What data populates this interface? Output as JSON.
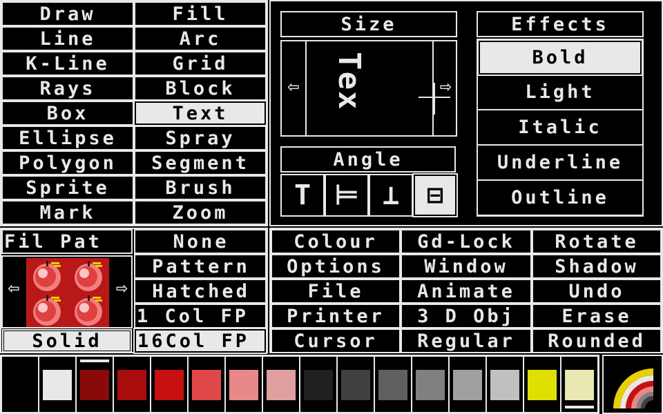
{
  "tools": {
    "left": [
      "Draw",
      "Line",
      "K-Line",
      "Rays",
      "Box",
      "Ellipse",
      "Polygon",
      "Sprite",
      "Mark"
    ],
    "right": [
      "Fill",
      "Arc",
      "Grid",
      "Block",
      "Text",
      "Spray",
      "Segment",
      "Brush",
      "Zoom"
    ],
    "selected": "Text"
  },
  "size_panel": {
    "title": "Size",
    "preview_text": "Tex",
    "left_arrow": "⇦",
    "right_arrow": "⇨"
  },
  "angle_panel": {
    "title": "Angle",
    "glyphs": [
      "T",
      "⊨",
      "⊥",
      "⊟"
    ],
    "selected_index": 3
  },
  "effects_panel": {
    "title": "Effects",
    "items": [
      "Bold",
      "Light",
      "Italic",
      "Underline",
      "Outline"
    ],
    "selected": "Bold"
  },
  "fill_pattern": {
    "title": "Fil Pat",
    "left_arrow": "⇦",
    "right_arrow": "⇨",
    "options": [
      "None",
      "Pattern",
      "Hatched",
      "1 Col FP",
      "16Col FP"
    ],
    "solid": "Solid",
    "selected": "16Col FP"
  },
  "menu": {
    "rows": [
      [
        "Colour",
        "Gd-Lock",
        "Rotate"
      ],
      [
        "Options",
        "Window",
        "Shadow"
      ],
      [
        "File",
        "Animate",
        "Undo"
      ],
      [
        "Printer",
        "3 D Obj",
        "Erase"
      ],
      [
        "Cursor",
        "Regular",
        "Rounded"
      ]
    ]
  },
  "palette": {
    "colors": [
      "#000000",
      "#e8e8e8",
      "#8a0a0a",
      "#a80c0c",
      "#c81010",
      "#e04848",
      "#e88888",
      "#e0a0a0",
      "#202020",
      "#404040",
      "#606060",
      "#808080",
      "#a0a0a0",
      "#c0c0c0",
      "#e0e000",
      "#e8e8b0"
    ],
    "foreground_index": 2,
    "background_index": 15
  },
  "colors": {
    "fg": "#e8e8e8",
    "bg": "#000000"
  }
}
